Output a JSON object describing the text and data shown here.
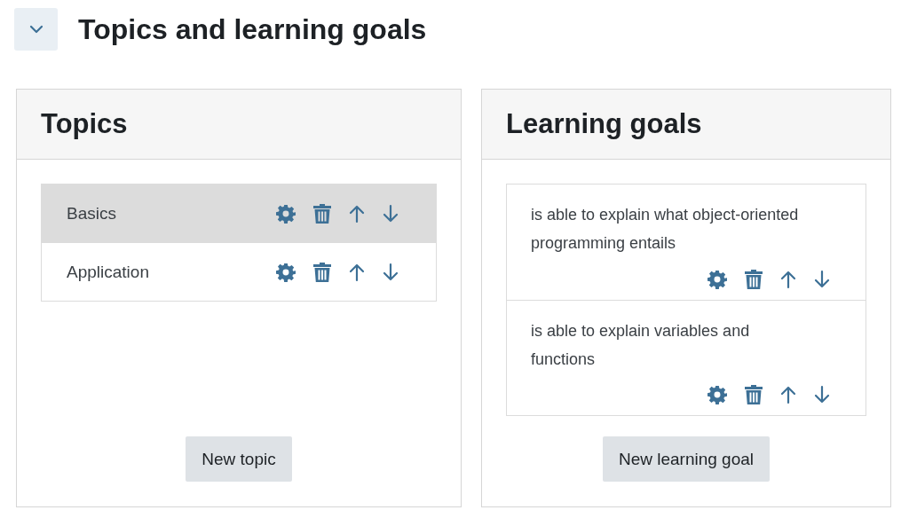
{
  "section": {
    "title": "Topics and learning goals",
    "expanded": true
  },
  "topics": {
    "title": "Topics",
    "items": [
      {
        "label": "Basics",
        "selected": true
      },
      {
        "label": "Application",
        "selected": false
      }
    ],
    "button": "New topic"
  },
  "learning_goals": {
    "title": "Learning goals",
    "items": [
      {
        "label": "is able to explain what object-oriented programming entails"
      },
      {
        "label": "is able to explain variables and functions"
      }
    ],
    "button": "New learning goal"
  }
}
